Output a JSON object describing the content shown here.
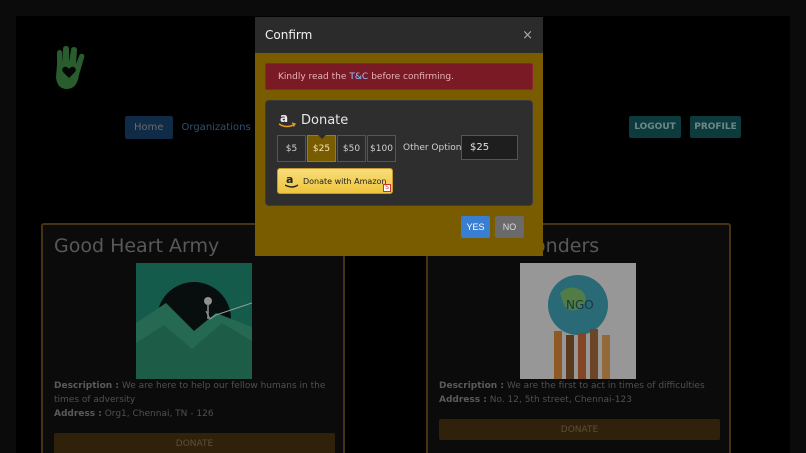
{
  "nav": {
    "home": "Home",
    "organizations": "Organizations",
    "logout": "LOGOUT",
    "profile": "PROFILE"
  },
  "cards": [
    {
      "title": "Good Heart Army",
      "desc_label": "Description :",
      "desc": "We are here to help our fellow humans in the times of adversity",
      "addr_label": "Address :",
      "addr": "Org1, Chennai, TN - 126",
      "donate": "DONATE"
    },
    {
      "title": "ponders",
      "desc_label": "Description :",
      "desc": "We are the first to act in times of difficulties",
      "addr_label": "Address :",
      "addr": "No. 12, 5th street, Chennai-123",
      "donate": "DONATE",
      "image_text": "NGO"
    }
  ],
  "modal": {
    "title": "Confirm",
    "close": "×",
    "alert_prefix": "Kindly read the",
    "alert_link": "T&C",
    "alert_suffix": "before confirming.",
    "donate_heading": "Donate",
    "amounts": [
      "$5",
      "$25",
      "$50",
      "$100"
    ],
    "selected_amount": "$25",
    "other_label": "Other Options",
    "other_value": "$25",
    "amazon_button": "Donate with Amazon",
    "amazon_badge": "S",
    "yes": "YES",
    "no": "NO"
  },
  "colors": {
    "modal_bg": "#7a5c00",
    "alert_bg": "#7a1a24",
    "yes_button": "#3a7ed1",
    "teal_buttons": "#14595c"
  }
}
